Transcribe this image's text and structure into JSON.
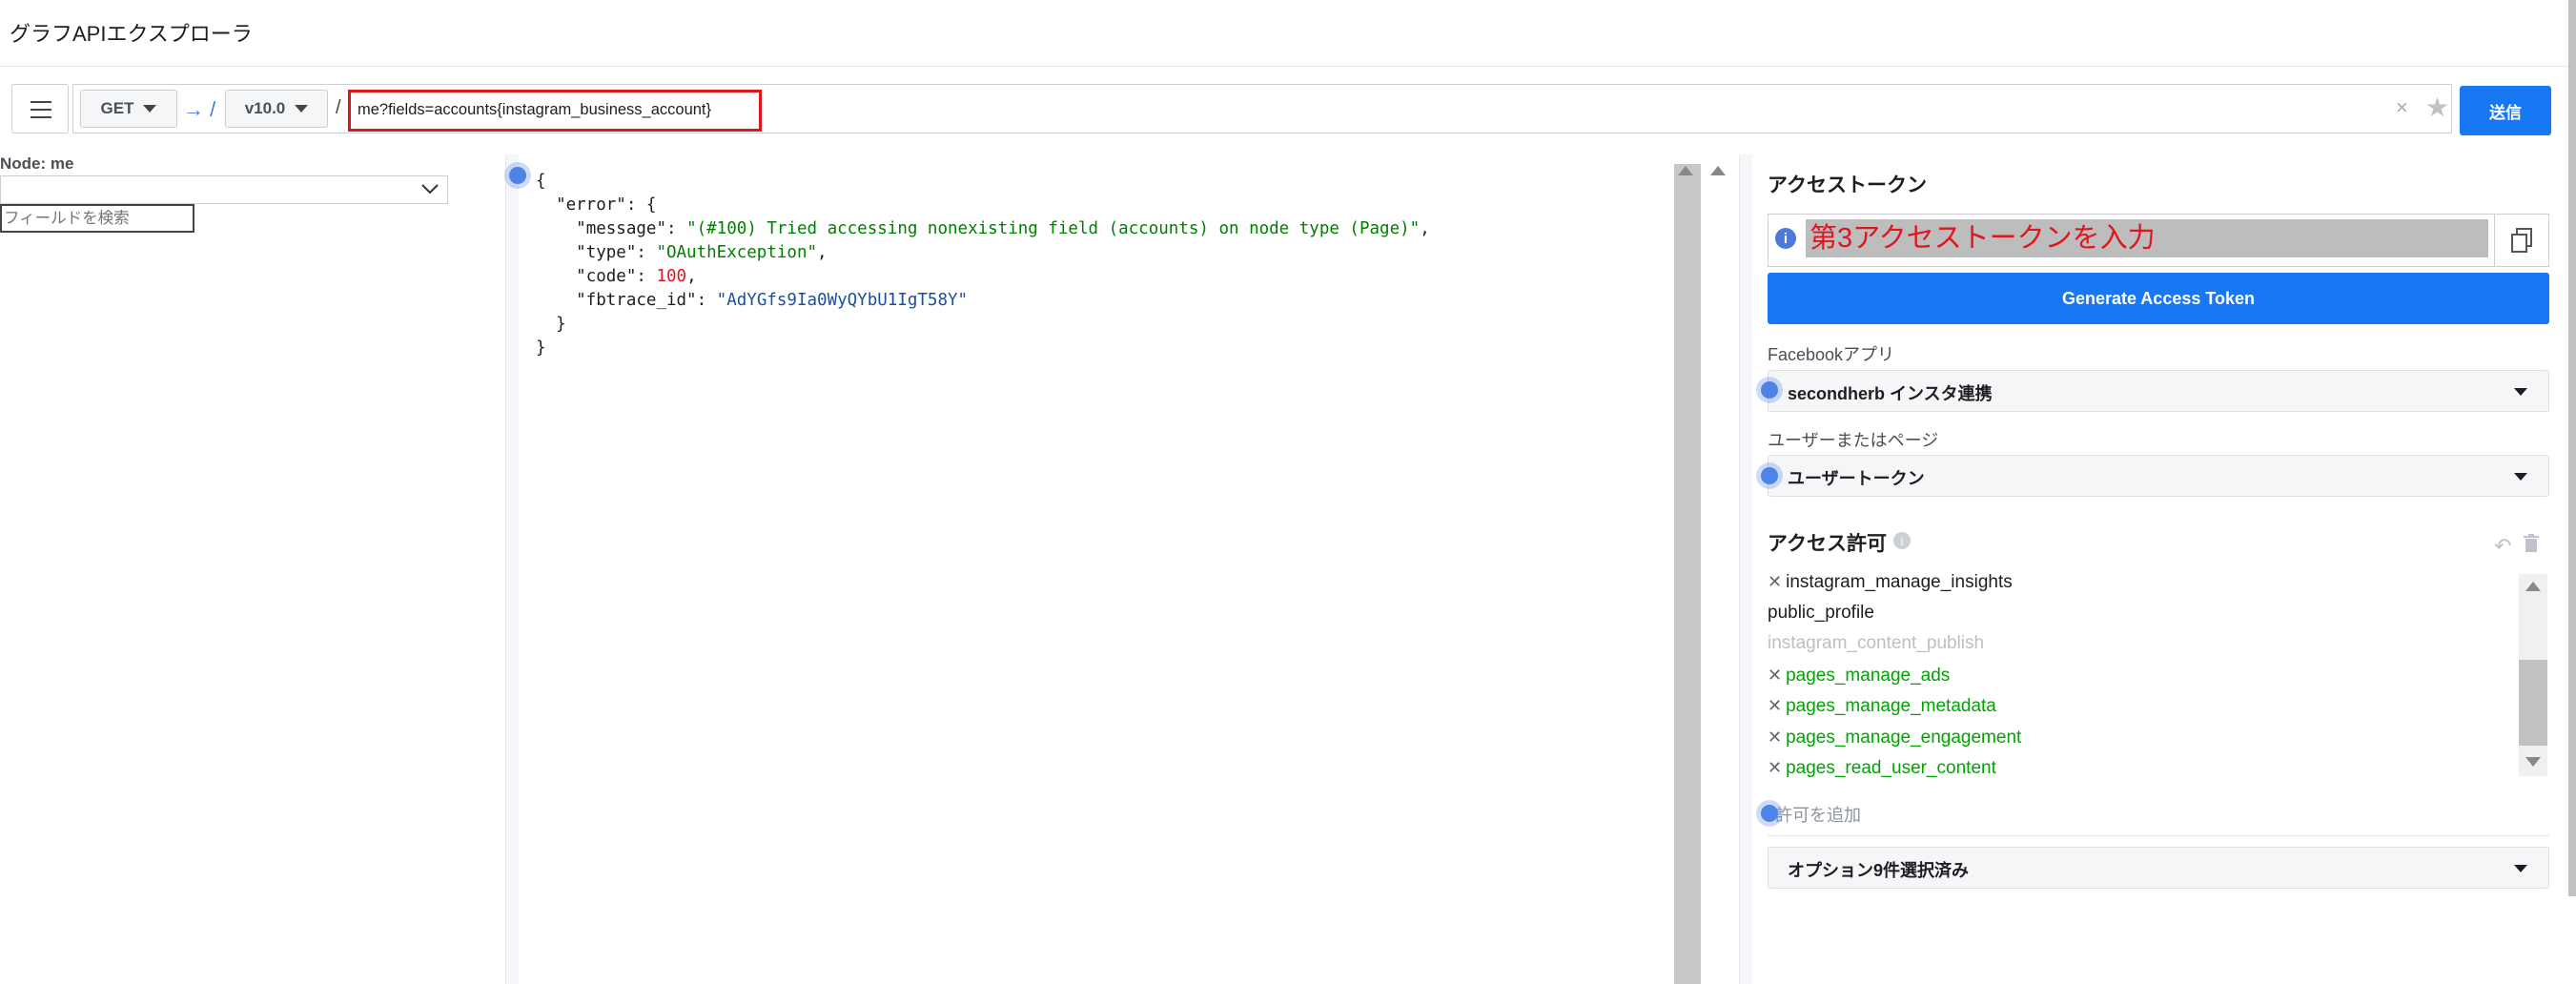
{
  "header": {
    "title": "グラフAPIエクスプローラ"
  },
  "toolbar": {
    "method": "GET",
    "arrow_slash": "→ /",
    "version": "v10.0",
    "slash": "/",
    "query": "me?fields=accounts{instagram_business_account}",
    "clear_glyph": "×",
    "star_glyph": "★",
    "submit_label": "送信",
    "colors": {
      "submit": "#1877f2",
      "query_highlight": "#e0161f"
    }
  },
  "left_panel": {
    "node_label": "Node: me",
    "search_placeholder": "フィールドを検索"
  },
  "response": {
    "lines": {
      "open": "{",
      "error_key": "\"error\"",
      "message_key": "\"message\"",
      "message_val": "\"(#100) Tried accessing nonexisting field (accounts) on node type (Page)\"",
      "type_key": "\"type\"",
      "type_val": "\"OAuthException\"",
      "code_key": "\"code\"",
      "code_val": "100",
      "fbtrace_key": "\"fbtrace_id\"",
      "fbtrace_val": "\"AdYGfs9Ia0WyQYbU1IgT58Y\"",
      "close_inner": "}",
      "close": "}"
    }
  },
  "right_panel": {
    "access_token_title": "アクセストークン",
    "token_value": "第3アクセストークンを入力",
    "generate_button": "Generate Access Token",
    "fb_app_label": "Facebookアプリ",
    "fb_app_value": "secondherb インスタ連携",
    "user_or_page_label": "ユーザーまたはページ",
    "user_or_page_value": "ユーザートークン",
    "permissions_title": "アクセス許可",
    "permissions": [
      {
        "name": "instagram_manage_insights",
        "removable": true,
        "style": "normal"
      },
      {
        "name": "public_profile",
        "removable": false,
        "style": "normal"
      },
      {
        "name": "instagram_content_publish",
        "removable": false,
        "style": "grey"
      },
      {
        "name": "pages_manage_ads",
        "removable": true,
        "style": "green"
      },
      {
        "name": "pages_manage_metadata",
        "removable": true,
        "style": "green"
      },
      {
        "name": "pages_manage_engagement",
        "removable": true,
        "style": "green"
      },
      {
        "name": "pages_read_user_content",
        "removable": true,
        "style": "green"
      }
    ],
    "add_permission": "許可を追加",
    "options_value": "オプション9件選択済み"
  }
}
